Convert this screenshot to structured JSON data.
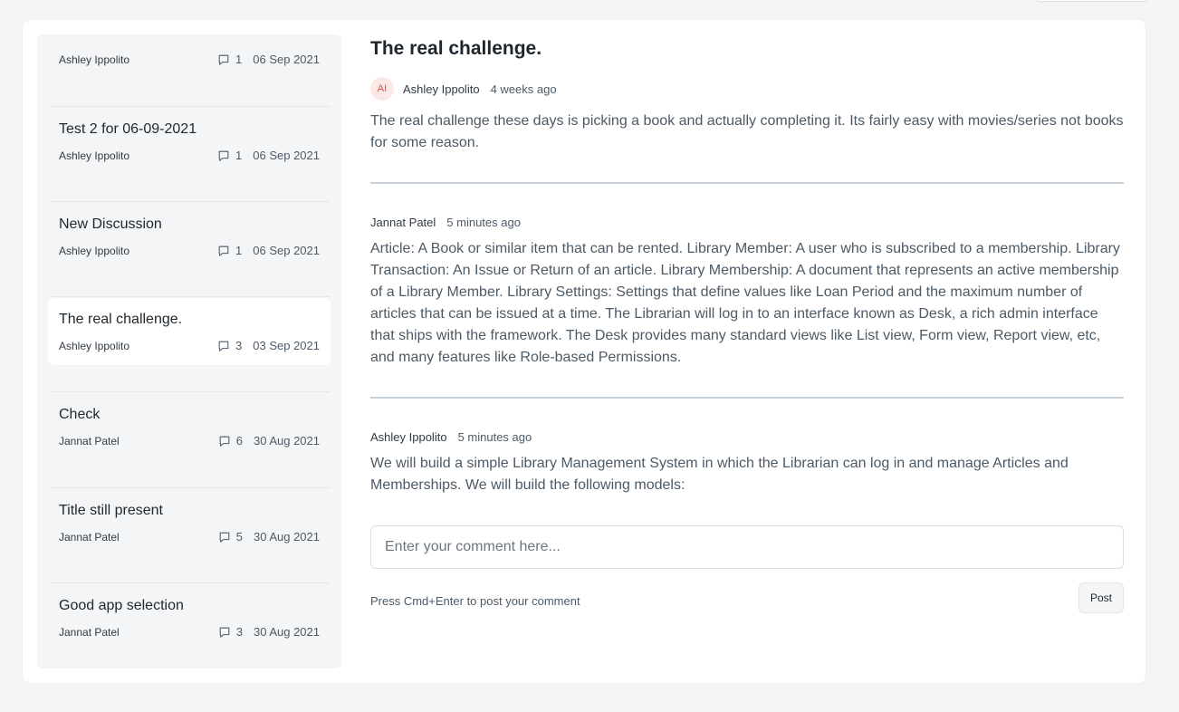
{
  "discussions": [
    {
      "title": "",
      "author": "Ashley Ippolito",
      "count": "1",
      "date": "06 Sep 2021"
    },
    {
      "title": "Test 2 for 06-09-2021",
      "author": "Ashley Ippolito",
      "count": "1",
      "date": "06 Sep 2021"
    },
    {
      "title": "New Discussion",
      "author": "Ashley Ippolito",
      "count": "1",
      "date": "06 Sep 2021"
    },
    {
      "title": "The real challenge.",
      "author": "Ashley Ippolito",
      "count": "3",
      "date": "03 Sep 2021"
    },
    {
      "title": "Check",
      "author": "Jannat Patel",
      "count": "6",
      "date": "30 Aug 2021"
    },
    {
      "title": "Title still present",
      "author": "Jannat Patel",
      "count": "5",
      "date": "30 Aug 2021"
    },
    {
      "title": "Good app selection",
      "author": "Jannat Patel",
      "count": "3",
      "date": "30 Aug 2021"
    }
  ],
  "thread": {
    "title": "The real challenge.",
    "avatar_initials": "AI",
    "posts": [
      {
        "author": "Ashley Ippolito",
        "time": "4 weeks ago",
        "text": "The real challenge these days is picking a book and actually completing it. Its fairly easy with movies/series not books for some reason."
      },
      {
        "author": "Jannat Patel",
        "time": "5 minutes ago",
        "text": "Article: A Book or similar item that can be rented. Library Member: A user who is subscribed to a membership. Library Transaction: An Issue or Return of an article. Library Membership: A document that represents an active membership of a Library Member. Library Settings: Settings that define values like Loan Period and the maximum number of articles that can be issued at a time. The Librarian will log in to an interface known as Desk, a rich admin interface that ships with the framework. The Desk provides many standard views like List view, Form view, Report view, etc, and many features like Role-based Permissions."
      },
      {
        "author": "Ashley Ippolito",
        "time": "5 minutes ago",
        "text": "We will build a simple Library Management System in which the Librarian can log in and manage Articles and Memberships. We will build the following models:"
      }
    ]
  },
  "composer": {
    "placeholder": "Enter your comment here...",
    "hint": "Press Cmd+Enter to post your comment",
    "post_label": "Post"
  },
  "icons": {
    "comment": "comment-icon",
    "avatar_bg": "#fde8e8",
    "avatar_fg": "#e24c4c"
  }
}
